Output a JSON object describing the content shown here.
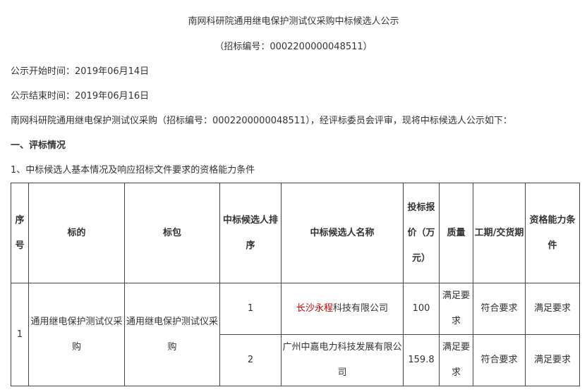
{
  "title": "南网科研院通用继电保护测试仪采购中标候选人公示",
  "subtitle": "（招标编号：0002200000048511）",
  "start_line": "公示开始时间：2019年06月14日",
  "end_line": "公示结束时间：2019年06月16日",
  "intro": "南网科研院通用继电保护测试仪采购（招标编号：0002200000048511），经评标委员会评审，现将中标候选人公示如下：",
  "section1": "一、评标情况",
  "subsection1": "1、中标候选人基本情况及响应招标文件要求的资格能力条件",
  "table": {
    "headers": [
      "序号",
      "标的",
      "标包",
      "中标候选人排序",
      "中标候选人名称",
      "投标报价（万元）",
      "质量",
      "工期/交货期",
      "资格能力条件"
    ],
    "group_index": "1",
    "subject": "通用继电保护测试仪采购",
    "package": "通用继电保护测试仪采购",
    "rows": [
      {
        "rank": "1",
        "name_highlight": "长沙永程",
        "name_rest": "科技有限公司",
        "price": "100",
        "quality": "满足要求",
        "delivery": "符合要求",
        "qualification": "满足要求"
      },
      {
        "rank": "2",
        "name_highlight": "",
        "name_rest": "广州中嘉电力科技发展有限公司",
        "price": "159.8",
        "quality": "满足要求",
        "delivery": "符合要求",
        "qualification": "满足要求"
      }
    ]
  },
  "colors": {
    "text": "#333333",
    "highlight": "#cc0000",
    "border": "#444444"
  }
}
